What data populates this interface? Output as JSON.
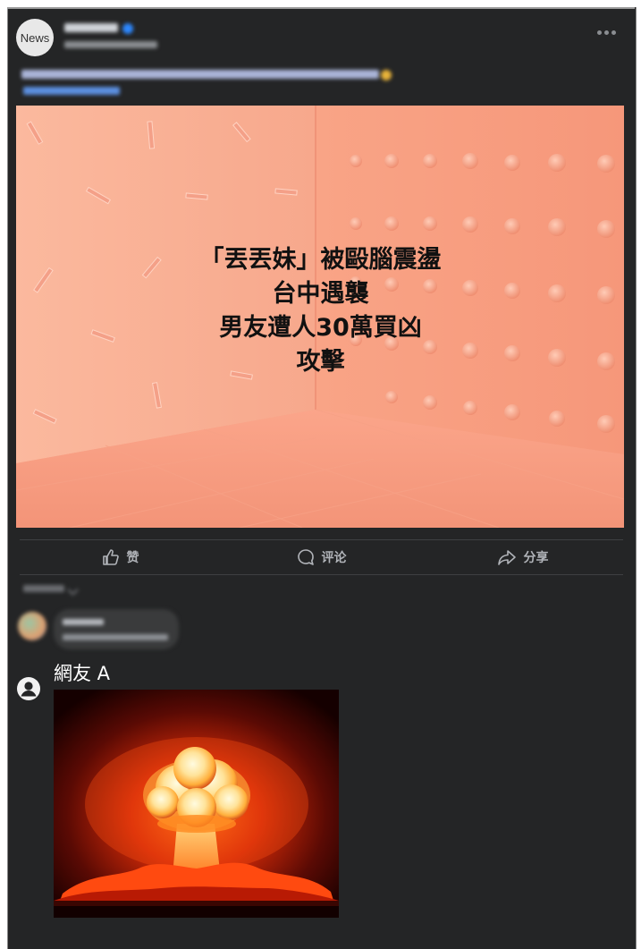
{
  "post": {
    "page_avatar_text": "News",
    "headline_lines": [
      "「丟丟妹」被毆腦震盪",
      "台中遇襲",
      "男友遭人30萬買凶",
      "攻擊"
    ]
  },
  "actions": {
    "like_label": "赞",
    "comment_label": "评论",
    "share_label": "分享"
  },
  "user_comment": {
    "author": "網友 A",
    "image_subject": "mushroom-cloud explosion"
  },
  "colors": {
    "background": "#242526",
    "hero_peach": "#f6a083",
    "action_text": "#b0b3b8"
  }
}
